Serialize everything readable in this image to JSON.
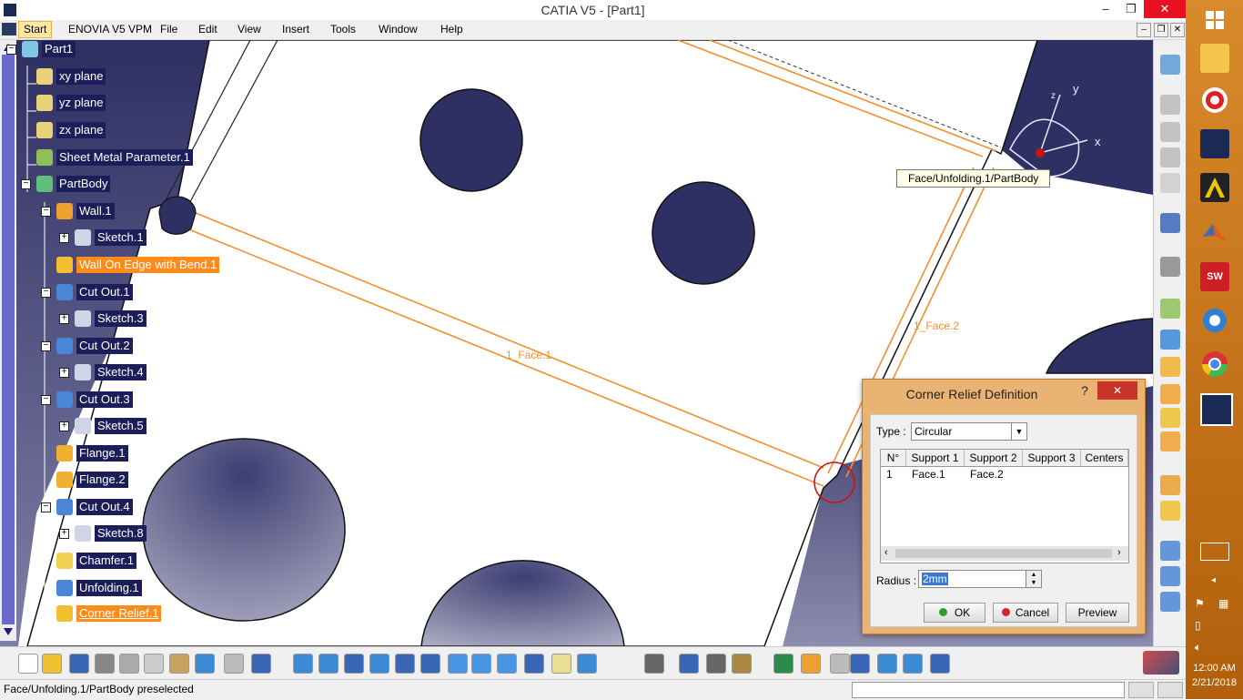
{
  "window": {
    "title": "CATIA V5 - [Part1]",
    "min": "–",
    "max": "❐",
    "close": "✕"
  },
  "menu": [
    "Start",
    "ENOVIA V5 VPM",
    "File",
    "Edit",
    "View",
    "Insert",
    "Tools",
    "Window",
    "Help"
  ],
  "tree": [
    {
      "label": "Part1",
      "icon": "part-icon"
    },
    {
      "label": "xy plane",
      "icon": "plane-icon"
    },
    {
      "label": "yz plane",
      "icon": "plane-icon"
    },
    {
      "label": "zx plane",
      "icon": "plane-icon"
    },
    {
      "label": "Sheet Metal Parameter.1",
      "icon": "sheet-metal-parameters-icon"
    },
    {
      "label": "PartBody",
      "icon": "partbody-gear-icon"
    },
    {
      "label": "Wall.1",
      "icon": "wall-icon"
    },
    {
      "label": "Sketch.1",
      "icon": "sketch-icon"
    },
    {
      "label": "Wall On Edge with Bend.1",
      "icon": "wall-on-edge-icon"
    },
    {
      "label": "Cut Out.1",
      "icon": "cutout-icon"
    },
    {
      "label": "Sketch.3",
      "icon": "sketch-icon"
    },
    {
      "label": "Cut Out.2",
      "icon": "cutout-icon"
    },
    {
      "label": "Sketch.4",
      "icon": "sketch-icon"
    },
    {
      "label": "Cut Out.3",
      "icon": "cutout-icon"
    },
    {
      "label": "Sketch.5",
      "icon": "sketch-icon"
    },
    {
      "label": "Flange.1",
      "icon": "flange-icon"
    },
    {
      "label": "Flange.2",
      "icon": "flange-icon"
    },
    {
      "label": "Cut Out.4",
      "icon": "cutout-icon"
    },
    {
      "label": "Sketch.8",
      "icon": "sketch-icon"
    },
    {
      "label": "Chamfer.1",
      "icon": "chamfer-icon"
    },
    {
      "label": "Unfolding.1",
      "icon": "unfolding-icon"
    },
    {
      "label": "Corner Relief.1",
      "icon": "corner-relief-icon"
    }
  ],
  "viewport": {
    "face1_label": "1_Face.1",
    "face2_label": "1_Face.2",
    "tooltip": "Face/Unfolding.1/PartBody",
    "compass_x": "x",
    "compass_y": "y",
    "compass_z": "z"
  },
  "dialog": {
    "title": "Corner Relief Definition",
    "help": "?",
    "close": "✕",
    "type_label": "Type :",
    "type_value": "Circular",
    "columns": [
      "N°",
      "Support 1",
      "Support 2",
      "Support 3",
      "Centers"
    ],
    "rows": [
      [
        "1",
        "Face.1",
        "Face.2",
        "",
        ""
      ]
    ],
    "radius_label": "Radius :",
    "radius_value": "2mm",
    "ok": "OK",
    "cancel": "Cancel",
    "preview": "Preview"
  },
  "status": {
    "text": "Face/Unfolding.1/PartBody preselected"
  },
  "taskbar": {
    "time": "12:00 AM",
    "date": "2/21/2018"
  },
  "colors": {
    "tree_bg": "#1c1e5a",
    "part_fill": "#3b3c6e",
    "edge_orange": "#f09030",
    "highlight": "#ff8c1a",
    "taskbar": "#c8741c"
  }
}
